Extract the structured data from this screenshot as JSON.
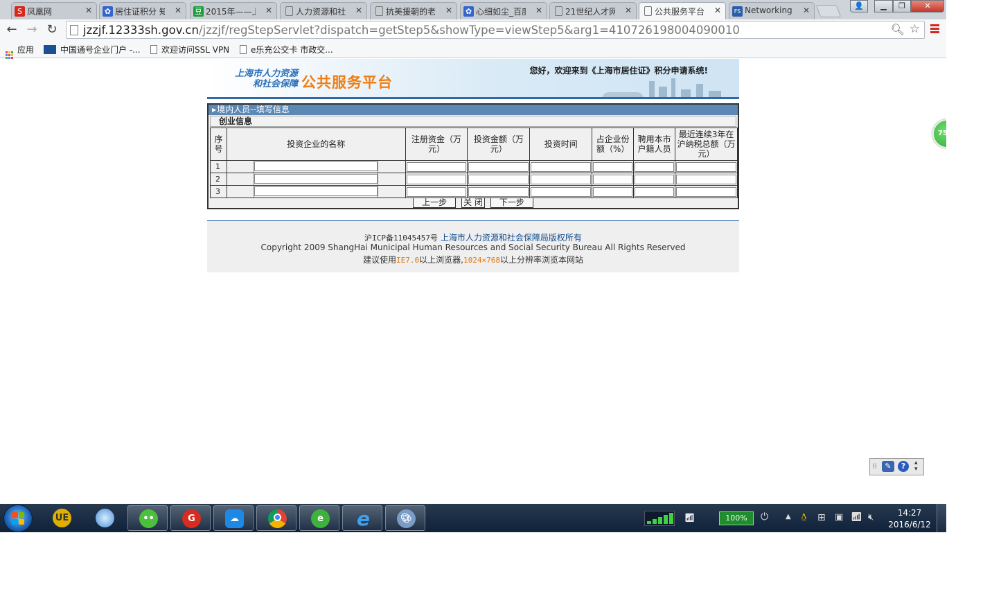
{
  "tabs": [
    {
      "label": "凤凰网",
      "fav_color": "#d8281e",
      "fav_glyph": "S"
    },
    {
      "label": "居住证积分 知",
      "fav_color": "#3366cc",
      "fav_glyph": "✿"
    },
    {
      "label": "2015年——上",
      "fav_color": "#1f9a3a",
      "fav_glyph": "豆"
    },
    {
      "label": "人力资源和社",
      "fav_color": "",
      "fav_glyph": ""
    },
    {
      "label": "抗美援朝的老",
      "fav_color": "",
      "fav_glyph": ""
    },
    {
      "label": "心细如尘_百度",
      "fav_color": "#3366cc",
      "fav_glyph": "✿"
    },
    {
      "label": "21世纪人才网",
      "fav_color": "",
      "fav_glyph": ""
    },
    {
      "label": "公共服务平台",
      "fav_color": "",
      "fav_glyph": "",
      "active": true
    },
    {
      "label": "Networking",
      "fav_color": "#2a5ea8",
      "fav_glyph": "FS"
    }
  ],
  "toolbar": {
    "url_host": "jzzjf.12333sh.gov.cn",
    "url_path": "/jzzjf/regStepServlet?dispatch=getStep5&showType=viewStep5&arg1=410726198004090010"
  },
  "bookmarks": {
    "apps": "应用",
    "item1": "中国通号企业门户 -...",
    "item2": "欢迎访问SSL VPN",
    "item3": "e乐充公交卡 市政交..."
  },
  "banner": {
    "org_line1": "上海市人力资源",
    "org_line2": "和社会保障",
    "platform": "公共服务平台",
    "welcome": "您好，欢迎来到《上海市居住证》积分申请系统!"
  },
  "form": {
    "section_title": "境内人员--填写信息",
    "subsection_title": "创业信息",
    "columns": {
      "seq": "序号",
      "company": "投资企业的名称",
      "registered_capital": "注册资金（万元）",
      "investment_amount": "投资金额（万元）",
      "investment_time": "投资时间",
      "share_ratio": "占企业份额（%）",
      "local_employees": "聘用本市户籍人员",
      "tax_total": "最近连续3年在沪纳税总额（万元）"
    },
    "rows": [
      "1",
      "2",
      "3"
    ],
    "buttons": {
      "prev": "上一步",
      "close": "关 闭",
      "next": "下一步"
    }
  },
  "footer": {
    "icp": "沪ICP备11045457号",
    "copyright_holder": "上海市人力资源和社会保障局版权所有",
    "copyright": "Copyright 2009 ShangHai Municipal Human Resources and Social Security Bureau All Rights Reserved",
    "advice_pre": "建议使用",
    "advice_browser": "IE7.0",
    "advice_mid": "以上浏览器,",
    "advice_res": "1024×768",
    "advice_post": "以上分辨率浏览本网站"
  },
  "float_ball": "75",
  "taskbar": {
    "battery": "100%",
    "battery_level": 1.0,
    "time": "14:27",
    "date": "2016/6/12"
  }
}
